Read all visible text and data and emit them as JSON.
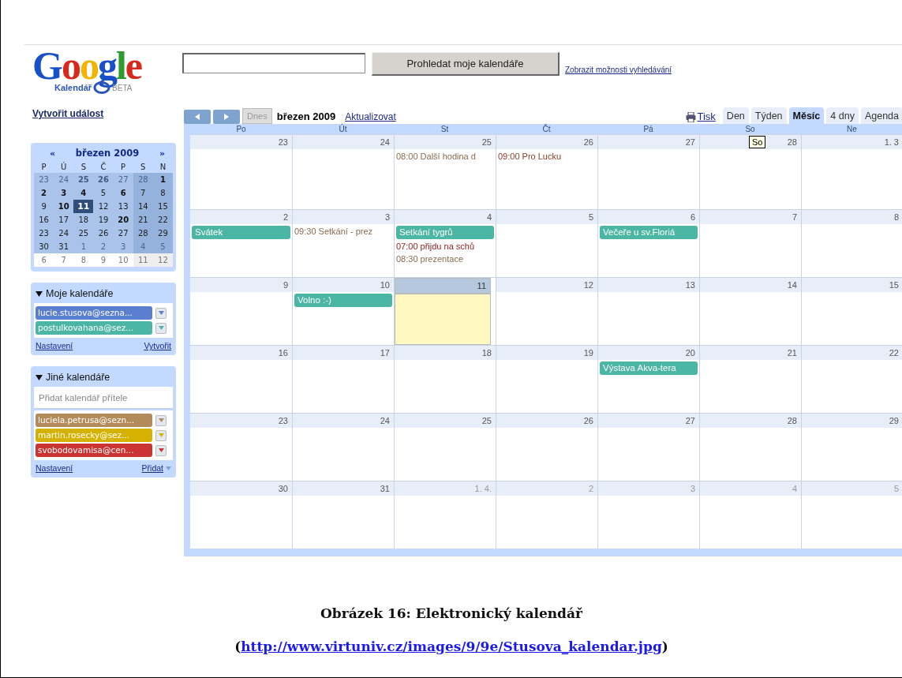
{
  "logo": {
    "wordmark": "Google",
    "product": "Kalendář",
    "badge": "BETA"
  },
  "search": {
    "button": "Prohledat moje kalendáře",
    "options_link": "Zobrazit možnosti vyhledávání"
  },
  "create_event": "Vytvořit událost",
  "mini_calendar": {
    "prev": "«",
    "title": "březen 2009",
    "next": "»",
    "weekdays": [
      "P",
      "Ú",
      "S",
      "Č",
      "P",
      "S",
      "N"
    ],
    "weeks": [
      {
        "in_view": true,
        "days": [
          {
            "day": "23",
            "dim": true,
            "bold": false,
            "selected": false
          },
          {
            "day": "24",
            "dim": true,
            "bold": false,
            "selected": false
          },
          {
            "day": "25",
            "dim": true,
            "bold": true,
            "selected": false
          },
          {
            "day": "26",
            "dim": true,
            "bold": true,
            "selected": false
          },
          {
            "day": "27",
            "dim": true,
            "bold": false,
            "selected": false
          },
          {
            "day": "28",
            "dim": true,
            "bold": false,
            "selected": false
          },
          {
            "day": "1",
            "dim": false,
            "bold": true,
            "selected": false
          }
        ]
      },
      {
        "in_view": true,
        "days": [
          {
            "day": "2",
            "dim": false,
            "bold": true,
            "selected": false
          },
          {
            "day": "3",
            "dim": false,
            "bold": true,
            "selected": false
          },
          {
            "day": "4",
            "dim": false,
            "bold": true,
            "selected": false
          },
          {
            "day": "5",
            "dim": false,
            "bold": false,
            "selected": false
          },
          {
            "day": "6",
            "dim": false,
            "bold": true,
            "selected": false
          },
          {
            "day": "7",
            "dim": false,
            "bold": false,
            "selected": false
          },
          {
            "day": "8",
            "dim": false,
            "bold": false,
            "selected": false
          }
        ]
      },
      {
        "in_view": true,
        "days": [
          {
            "day": "9",
            "dim": false,
            "bold": false,
            "selected": false
          },
          {
            "day": "10",
            "dim": false,
            "bold": true,
            "selected": false
          },
          {
            "day": "11",
            "dim": false,
            "bold": false,
            "selected": true
          },
          {
            "day": "12",
            "dim": false,
            "bold": false,
            "selected": false
          },
          {
            "day": "13",
            "dim": false,
            "bold": false,
            "selected": false
          },
          {
            "day": "14",
            "dim": false,
            "bold": false,
            "selected": false
          },
          {
            "day": "15",
            "dim": false,
            "bold": false,
            "selected": false
          }
        ]
      },
      {
        "in_view": true,
        "days": [
          {
            "day": "16",
            "dim": false,
            "bold": false,
            "selected": false
          },
          {
            "day": "17",
            "dim": false,
            "bold": false,
            "selected": false
          },
          {
            "day": "18",
            "dim": false,
            "bold": false,
            "selected": false
          },
          {
            "day": "19",
            "dim": false,
            "bold": false,
            "selected": false
          },
          {
            "day": "20",
            "dim": false,
            "bold": true,
            "selected": false
          },
          {
            "day": "21",
            "dim": false,
            "bold": false,
            "selected": false
          },
          {
            "day": "22",
            "dim": false,
            "bold": false,
            "selected": false
          }
        ]
      },
      {
        "in_view": true,
        "days": [
          {
            "day": "23",
            "dim": false,
            "bold": false,
            "selected": false
          },
          {
            "day": "24",
            "dim": false,
            "bold": false,
            "selected": false
          },
          {
            "day": "25",
            "dim": false,
            "bold": false,
            "selected": false
          },
          {
            "day": "26",
            "dim": false,
            "bold": false,
            "selected": false
          },
          {
            "day": "27",
            "dim": false,
            "bold": false,
            "selected": false
          },
          {
            "day": "28",
            "dim": false,
            "bold": false,
            "selected": false
          },
          {
            "day": "29",
            "dim": false,
            "bold": false,
            "selected": false
          }
        ]
      },
      {
        "in_view": true,
        "days": [
          {
            "day": "30",
            "dim": false,
            "bold": false,
            "selected": false
          },
          {
            "day": "31",
            "dim": false,
            "bold": false,
            "selected": false
          },
          {
            "day": "1",
            "dim": true,
            "bold": false,
            "selected": false
          },
          {
            "day": "2",
            "dim": true,
            "bold": false,
            "selected": false
          },
          {
            "day": "3",
            "dim": true,
            "bold": false,
            "selected": false
          },
          {
            "day": "4",
            "dim": true,
            "bold": false,
            "selected": false
          },
          {
            "day": "5",
            "dim": true,
            "bold": false,
            "selected": false
          }
        ]
      },
      {
        "in_view": false,
        "days": [
          {
            "day": "6",
            "dim": true,
            "bold": false,
            "selected": false
          },
          {
            "day": "7",
            "dim": true,
            "bold": false,
            "selected": false
          },
          {
            "day": "8",
            "dim": true,
            "bold": false,
            "selected": false
          },
          {
            "day": "9",
            "dim": true,
            "bold": false,
            "selected": false
          },
          {
            "day": "10",
            "dim": true,
            "bold": false,
            "selected": false
          },
          {
            "day": "11",
            "dim": true,
            "bold": false,
            "selected": false
          },
          {
            "day": "12",
            "dim": true,
            "bold": false,
            "selected": false
          }
        ]
      }
    ]
  },
  "my_calendars": {
    "title": "Moje kalendáře",
    "expanded": true,
    "items": [
      {
        "name": "lucie.stusova@sezna...",
        "color": "#5b7fd0"
      },
      {
        "name": "postulkovahana@sez...",
        "color": "#4cb6a4"
      }
    ],
    "settings": "Nastavení",
    "create": "Vytvořit"
  },
  "other_calendars": {
    "title": "Jiné kalendáře",
    "expanded": true,
    "placeholder": "Přidat kalendář přítele",
    "items": [
      {
        "name": "luciela.petrusa@sezn...",
        "color": "#b38b5a"
      },
      {
        "name": "martin.rosecky@sez...",
        "color": "#d6b200"
      },
      {
        "name": "svobodovamisa@cen...",
        "color": "#cc3333"
      }
    ],
    "settings": "Nastavení",
    "add": "Přidat"
  },
  "toolbar": {
    "today": "Dnes",
    "today_disabled": true,
    "title": "březen 2009",
    "refresh": "Aktualizovat",
    "print": "Tisk",
    "views": [
      {
        "label": "Den",
        "selected": false
      },
      {
        "label": "Týden",
        "selected": false
      },
      {
        "label": "Měsíc",
        "selected": true
      },
      {
        "label": "4 dny",
        "selected": false
      },
      {
        "label": "Agenda",
        "selected": false
      }
    ]
  },
  "month_grid": {
    "weekdays": [
      "Po",
      "Út",
      "St",
      "Čt",
      "Pá",
      "So",
      "Ne"
    ],
    "tooltip": "So",
    "weeks": [
      {
        "days": [
          {
            "date": "23",
            "dim": false,
            "today": false
          },
          {
            "date": "24",
            "dim": false,
            "today": false
          },
          {
            "date": "25",
            "dim": false,
            "today": false,
            "events": [
              {
                "kind": "timed",
                "text": "08:00 Další hodina d",
                "color": "#8c6a4e"
              }
            ]
          },
          {
            "date": "26",
            "dim": false,
            "today": false,
            "events": [
              {
                "kind": "timed",
                "text": "09:00 Pro Lucku",
                "color": "#8b3a2a"
              }
            ]
          },
          {
            "date": "27",
            "dim": false,
            "today": false
          },
          {
            "date": "28",
            "dim": false,
            "today": false
          },
          {
            "date": "1. 3",
            "dim": false,
            "today": false
          }
        ]
      },
      {
        "days": [
          {
            "date": "2",
            "dim": false,
            "today": false,
            "events": [
              {
                "kind": "allday",
                "text": "Svátek",
                "color": "#4cb6a4"
              }
            ]
          },
          {
            "date": "3",
            "dim": false,
            "today": false,
            "events": [
              {
                "kind": "timed",
                "text": "09:30 Setkání - prez",
                "color": "#8c6a4e"
              }
            ]
          },
          {
            "date": "4",
            "dim": false,
            "today": false,
            "events": [
              {
                "kind": "allday",
                "text": "Setkání tygrů",
                "color": "#4cb6a4"
              },
              {
                "kind": "timed",
                "text": "07:00 přijdu na schů",
                "color": "#992222"
              },
              {
                "kind": "timed",
                "text": "08:30 prezentace",
                "color": "#8c6a4e"
              }
            ]
          },
          {
            "date": "5",
            "dim": false,
            "today": false
          },
          {
            "date": "6",
            "dim": false,
            "today": false,
            "events": [
              {
                "kind": "allday",
                "text": "Večeře u sv.Floriá",
                "color": "#4cb6a4"
              }
            ]
          },
          {
            "date": "7",
            "dim": false,
            "today": false
          },
          {
            "date": "8",
            "dim": false,
            "today": false
          }
        ]
      },
      {
        "days": [
          {
            "date": "9",
            "dim": false,
            "today": false
          },
          {
            "date": "10",
            "dim": false,
            "today": false,
            "events": [
              {
                "kind": "allday",
                "text": "Volno :-)",
                "color": "#4cb6a4"
              }
            ]
          },
          {
            "date": "11",
            "dim": false,
            "today": true
          },
          {
            "date": "12",
            "dim": false,
            "today": false
          },
          {
            "date": "13",
            "dim": false,
            "today": false
          },
          {
            "date": "14",
            "dim": false,
            "today": false
          },
          {
            "date": "15",
            "dim": false,
            "today": false
          }
        ]
      },
      {
        "days": [
          {
            "date": "16",
            "dim": false,
            "today": false
          },
          {
            "date": "17",
            "dim": false,
            "today": false
          },
          {
            "date": "18",
            "dim": false,
            "today": false
          },
          {
            "date": "19",
            "dim": false,
            "today": false
          },
          {
            "date": "20",
            "dim": false,
            "today": false,
            "events": [
              {
                "kind": "allday",
                "text": "Výstava Akva-tera",
                "color": "#4cb6a4"
              }
            ]
          },
          {
            "date": "21",
            "dim": false,
            "today": false
          },
          {
            "date": "22",
            "dim": false,
            "today": false
          }
        ]
      },
      {
        "days": [
          {
            "date": "23",
            "dim": false,
            "today": false
          },
          {
            "date": "24",
            "dim": false,
            "today": false
          },
          {
            "date": "25",
            "dim": false,
            "today": false
          },
          {
            "date": "26",
            "dim": false,
            "today": false
          },
          {
            "date": "27",
            "dim": false,
            "today": false
          },
          {
            "date": "28",
            "dim": false,
            "today": false
          },
          {
            "date": "29",
            "dim": false,
            "today": false
          }
        ]
      },
      {
        "days": [
          {
            "date": "30",
            "dim": false,
            "today": false
          },
          {
            "date": "31",
            "dim": false,
            "today": false
          },
          {
            "date": "1. 4.",
            "dim": true,
            "today": false
          },
          {
            "date": "2",
            "dim": true,
            "today": false
          },
          {
            "date": "3",
            "dim": true,
            "today": false
          },
          {
            "date": "4",
            "dim": true,
            "today": false
          },
          {
            "date": "5",
            "dim": true,
            "today": false
          }
        ]
      }
    ]
  },
  "caption": {
    "title": "Obrázek 16: Elektronický kalendář",
    "prefix": "(",
    "link": "http://www.virtuniv.cz/images/9/9e/Stusova_kalendar.jpg",
    "suffix": ")"
  }
}
